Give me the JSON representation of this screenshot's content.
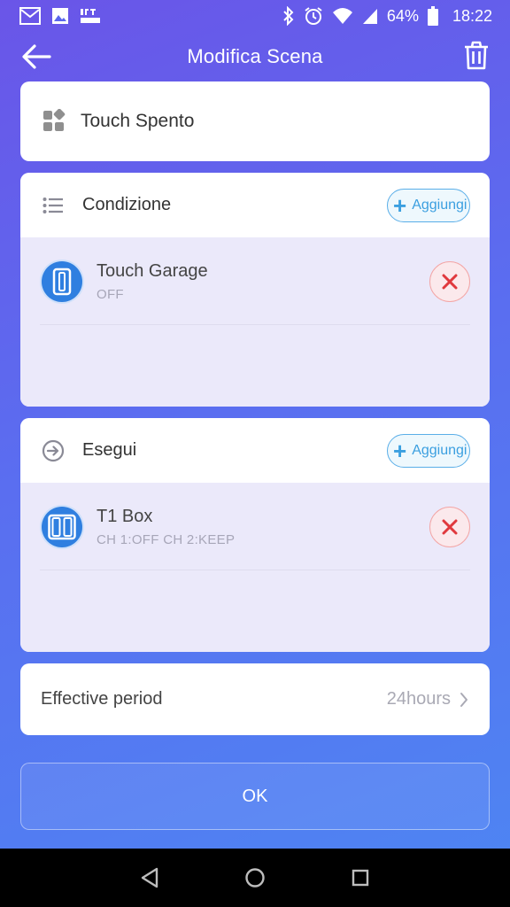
{
  "status_bar": {
    "battery_percent": "64%",
    "time": "18:22",
    "left_icons": [
      "gmail-icon",
      "image-icon",
      "ifttt-icon"
    ],
    "right_icons": [
      "bluetooth-icon",
      "alarm-icon",
      "wifi-icon",
      "signal-icon",
      "battery-icon"
    ]
  },
  "header": {
    "title": "Modifica Scena",
    "back_icon": "arrow-left-icon",
    "delete_icon": "trash-icon"
  },
  "scene": {
    "name": "Touch Spento",
    "icon": "grid-apps-icon"
  },
  "condition": {
    "label": "Condizione",
    "icon": "list-icon",
    "add_label": "Aggiungi",
    "items": [
      {
        "name": "Touch Garage",
        "status": "OFF",
        "icon": "single-switch-icon"
      }
    ]
  },
  "execute": {
    "label": "Esegui",
    "icon": "arrow-circle-right-icon",
    "add_label": "Aggiungi",
    "items": [
      {
        "name": "T1 Box",
        "status": "CH 1:OFF CH 2:KEEP",
        "icon": "double-switch-icon"
      }
    ]
  },
  "effective_period": {
    "label": "Effective period",
    "value": "24hours"
  },
  "ok_label": "OK",
  "colors": {
    "accent_blue": "#3b9fe0",
    "remove_red": "#e0393e",
    "device_blue": "#2f7fe0",
    "gradient_start": "#6a55e8",
    "gradient_end": "#4d86f3"
  }
}
